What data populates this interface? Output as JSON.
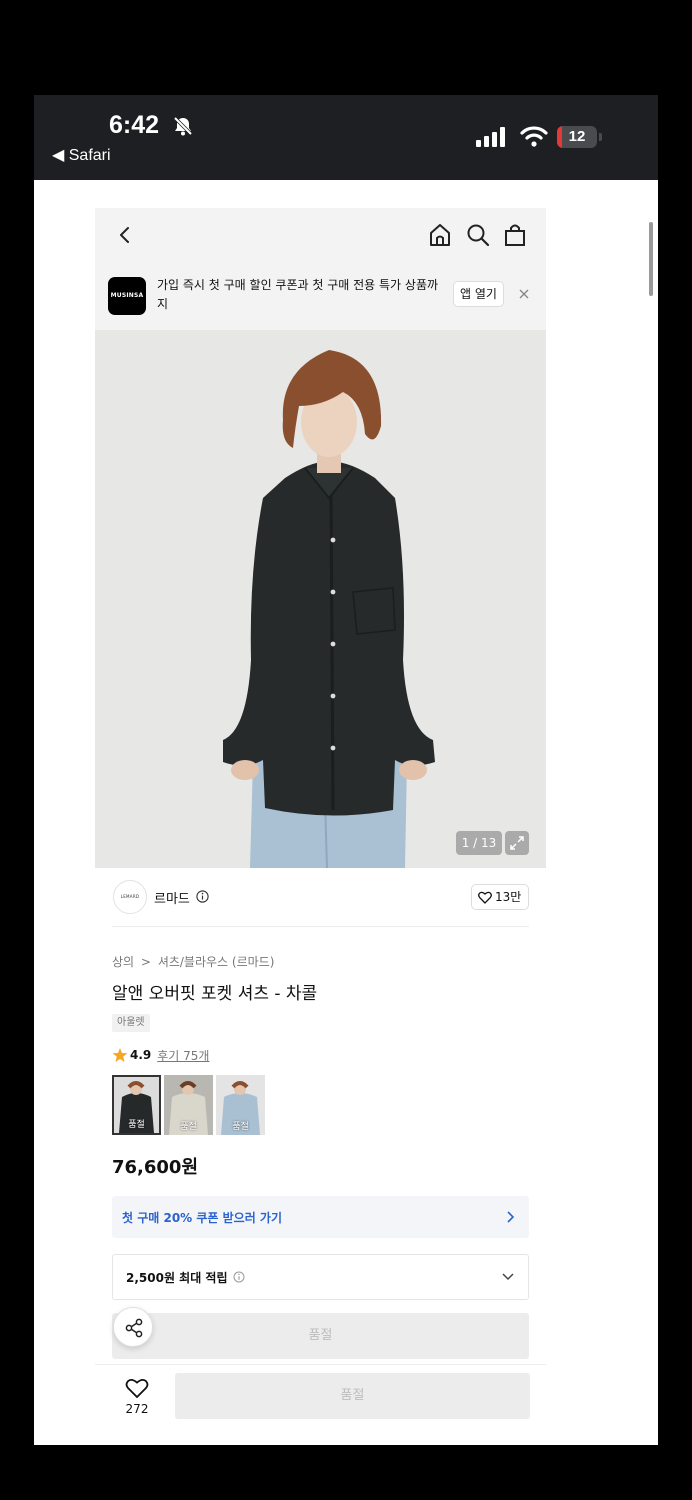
{
  "status_bar": {
    "time": "6:42",
    "back_app": "◀ Safari",
    "battery_level": "12",
    "battery_fraction": 0.12,
    "battery_color": "#e53935"
  },
  "nav": {
    "icons": [
      "chevron-left-icon",
      "home-icon",
      "search-icon",
      "shopping-bag-icon"
    ]
  },
  "banner": {
    "logo": "MUSINSA",
    "text": "가입 즉시 첫 구매 할인 쿠폰과 첫 구매 전용 특가 상품까지",
    "open_label": "앱 열기",
    "close_icon": "close-icon"
  },
  "hero": {
    "counter": "1 / 13",
    "current_image": 1,
    "total_images": 13,
    "expand_icon": "expand-icon"
  },
  "brand": {
    "logo_text": "LEMARD",
    "name": "르마드",
    "likes": "13만"
  },
  "product": {
    "breadcrumb": [
      "상의",
      ">",
      "셔츠/블라우스 (르마드)"
    ],
    "title": "알앤 오버핏 포켓 셔츠 - 차콜",
    "badge": "아울렛",
    "rating": "4.9",
    "review_link": "후기 75개",
    "swatches": [
      {
        "label": "품절",
        "selected": true
      },
      {
        "label": "품절",
        "selected": false
      },
      {
        "label": "품절",
        "selected": false
      }
    ],
    "price": "76,600원"
  },
  "coupon": {
    "text": "첫 구매 20% 쿠폰 받으러 가기",
    "color": "#2a63ce"
  },
  "points": {
    "text": "2,500원 최대 적립"
  },
  "actions": {
    "soldout_label": "품절",
    "wishlist_count": "272",
    "buy_label": "품절"
  }
}
